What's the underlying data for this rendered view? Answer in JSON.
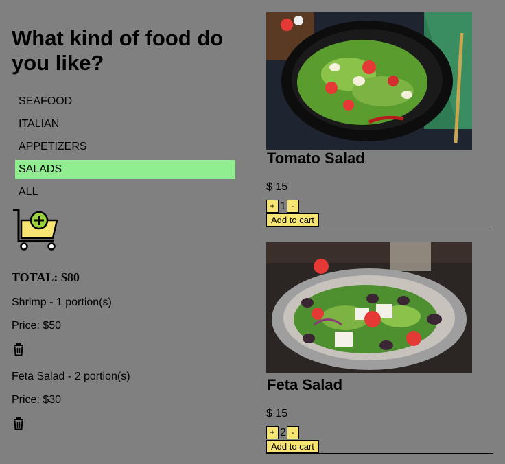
{
  "heading": "What kind of food do you like?",
  "categories": [
    {
      "label": "SEAFOOD",
      "active": false
    },
    {
      "label": "ITALIAN",
      "active": false
    },
    {
      "label": "APPETIZERS",
      "active": false
    },
    {
      "label": "SALADS",
      "active": true
    },
    {
      "label": "ALL",
      "active": false
    }
  ],
  "cart": {
    "icon": "cart-add-icon",
    "total": "TOTAL: $80",
    "items": [
      {
        "title": "Shrimp - 1 portion(s)",
        "price": "Price: $50",
        "icon": "trash-icon"
      },
      {
        "title": "Feta Salad - 2 portion(s)",
        "price": "Price: $30",
        "icon": "trash-icon"
      }
    ]
  },
  "products": [
    {
      "name": "Tomato Salad",
      "price": "$ 15",
      "qty": "1",
      "plus": "+",
      "minus": "-",
      "add": "Add to cart"
    },
    {
      "name": "Feta Salad",
      "price": "$ 15",
      "qty": "2",
      "plus": "+",
      "minus": "-",
      "add": "Add to cart"
    }
  ],
  "colors": {
    "background": "#808080",
    "active_category": "#90ee90",
    "button": "#f6e473"
  }
}
